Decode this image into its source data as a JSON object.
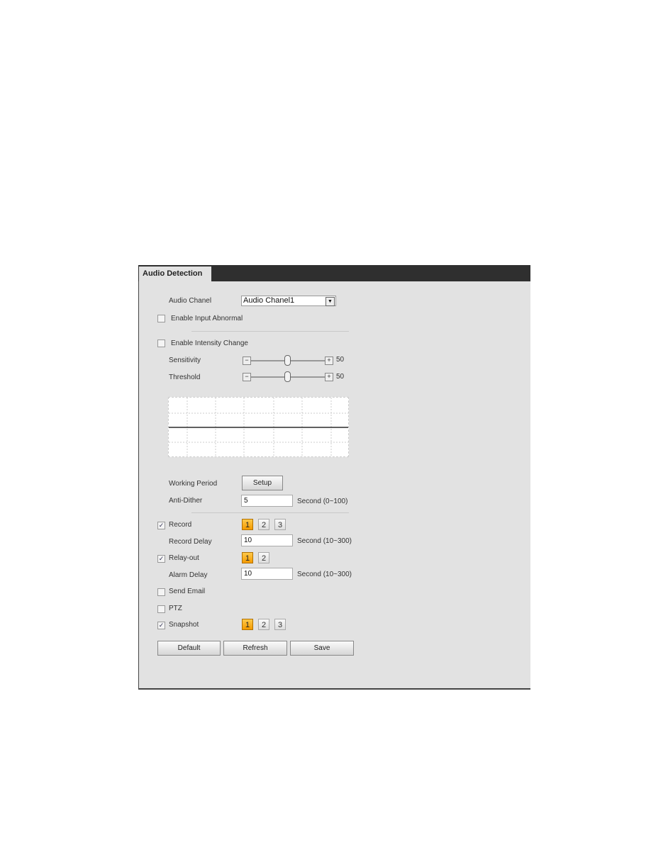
{
  "tab": "Audio Detection",
  "audio_channel": {
    "label": "Audio Chanel",
    "value": "Audio Chanel1"
  },
  "enable_input_abnormal": {
    "label": "Enable Input Abnormal",
    "checked": false
  },
  "enable_intensity_change": {
    "label": "Enable Intensity Change",
    "checked": false
  },
  "sensitivity": {
    "label": "Sensitivity",
    "value": "50",
    "minus": "−",
    "plus": "+"
  },
  "threshold": {
    "label": "Threshold",
    "value": "50",
    "minus": "−",
    "plus": "+"
  },
  "working_period": {
    "label": "Working Period",
    "button": "Setup"
  },
  "anti_dither": {
    "label": "Anti-Dither",
    "value": "5",
    "unit": "Second (0~100)"
  },
  "record": {
    "label": "Record",
    "checked": true,
    "channels": [
      "1",
      "2",
      "3"
    ],
    "active": "1"
  },
  "record_delay": {
    "label": "Record Delay",
    "value": "10",
    "unit": "Second (10~300)"
  },
  "relay_out": {
    "label": "Relay-out",
    "checked": true,
    "channels": [
      "1",
      "2"
    ],
    "active": "1"
  },
  "alarm_delay": {
    "label": "Alarm Delay",
    "value": "10",
    "unit": "Second (10~300)"
  },
  "send_email": {
    "label": "Send Email",
    "checked": false
  },
  "ptz": {
    "label": "PTZ",
    "checked": false
  },
  "snapshot": {
    "label": "Snapshot",
    "checked": true,
    "channels": [
      "1",
      "2",
      "3"
    ],
    "active": "1"
  },
  "buttons": {
    "default": "Default",
    "refresh": "Refresh",
    "save": "Save"
  },
  "check_mark": "✓",
  "colors": {
    "active_channel": "#f49a00",
    "header": "#2f2f2f"
  }
}
